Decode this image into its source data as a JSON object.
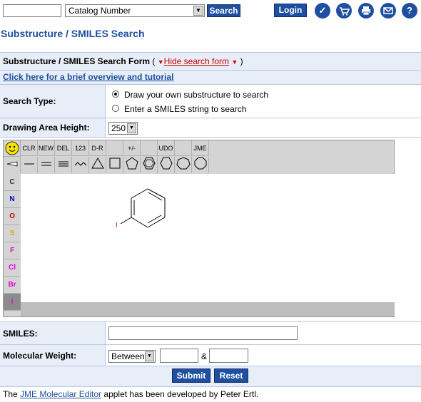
{
  "topbar": {
    "search_value": "",
    "catalog_select": "Catalog Number",
    "search_btn": "Search",
    "login_btn": "Login",
    "icons": [
      "check-icon",
      "cart-icon",
      "print-icon",
      "mail-icon",
      "help-icon"
    ]
  },
  "page_title": "Substructure / SMILES Search",
  "form": {
    "header": "Substructure / SMILES Search Form",
    "paren_open": "(",
    "hide_link": "Hide search form",
    "paren_close": ")",
    "tutorial_link": "Click here for a brief overview and tutorial",
    "search_type_label": "Search Type:",
    "search_type_options": [
      "Draw your own substructure to search",
      "Enter a SMILES string to search"
    ],
    "search_type_selected": 0,
    "draw_height_label": "Drawing Area Height:",
    "draw_height_value": "250",
    "smiles_label": "SMILES:",
    "smiles_value": "",
    "mw_label": "Molecular Weight:",
    "mw_mode": "Between",
    "mw_and": "&",
    "mw_min": "",
    "mw_max": "",
    "submit_btn": "Submit",
    "reset_btn": "Reset"
  },
  "jme": {
    "top_buttons": [
      "CLR",
      "NEW",
      "DEL",
      "123",
      "D-R",
      "",
      "+/-",
      "",
      "UDO",
      "",
      "JME"
    ],
    "atoms": [
      "C",
      "N",
      "O",
      "S",
      "F",
      "Cl",
      "Br",
      "I"
    ],
    "atom_colors": [
      "#333333",
      "#0000cc",
      "#cc0000",
      "#c8b400",
      "#e000e0",
      "#e000e0",
      "#e000e0",
      "#e000e0"
    ],
    "molecule_atom_label": "I"
  },
  "footer": {
    "prefix": "The ",
    "link": "JME Molecular Editor",
    "suffix": " applet has been developed by Peter Ertl."
  }
}
